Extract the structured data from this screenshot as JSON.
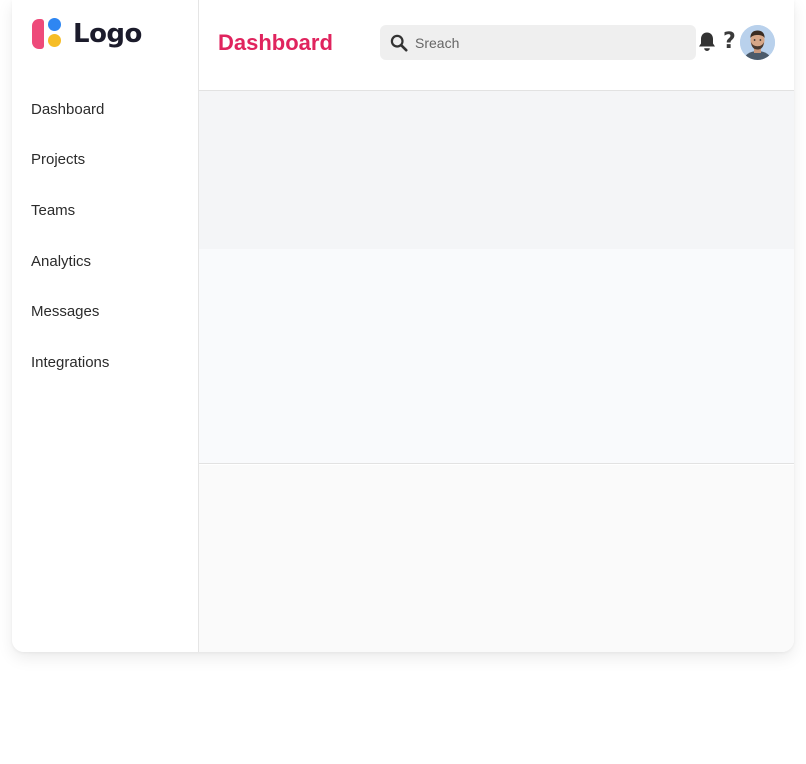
{
  "brand": {
    "logo_text": "Logo",
    "colors": {
      "pink": "#ee4a7a",
      "blue": "#2e86f2",
      "yellow": "#f6bd26"
    }
  },
  "sidebar": {
    "items": [
      {
        "label": "Dashboard"
      },
      {
        "label": "Projects"
      },
      {
        "label": "Teams"
      },
      {
        "label": "Analytics"
      },
      {
        "label": "Messages"
      },
      {
        "label": "Integrations"
      }
    ]
  },
  "header": {
    "title": "Dashboard",
    "title_color": "#e0245e",
    "search": {
      "placeholder": "Sreach",
      "value": ""
    },
    "icons": {
      "notifications": "bell-icon",
      "help": "help-icon",
      "user": "avatar"
    },
    "help_glyph": "?"
  }
}
